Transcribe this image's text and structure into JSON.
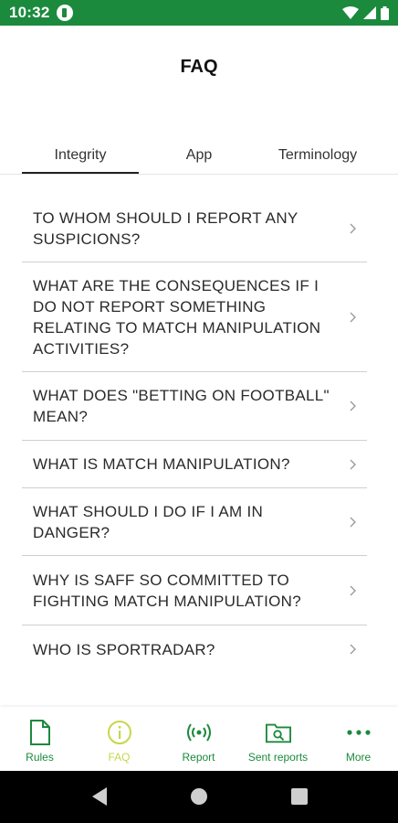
{
  "status_bar": {
    "time": "10:32"
  },
  "header": {
    "title": "FAQ"
  },
  "tabs": [
    {
      "label": "Integrity"
    },
    {
      "label": "App"
    },
    {
      "label": "Terminology"
    }
  ],
  "faq": [
    {
      "question": "TO WHOM SHOULD I REPORT ANY SUSPICIONS?"
    },
    {
      "question": "WHAT ARE THE CONSEQUENCES IF I DO NOT REPORT SOMETHING RELATING TO MATCH MANIPULATION ACTIVITIES?"
    },
    {
      "question": "WHAT DOES \"BETTING ON FOOTBALL\" MEAN?"
    },
    {
      "question": "WHAT IS MATCH MANIPULATION?"
    },
    {
      "question": "WHAT SHOULD I DO IF I AM IN DANGER?"
    },
    {
      "question": "WHY IS SAFF SO COMMITTED TO FIGHTING MATCH MANIPULATION?"
    },
    {
      "question": "WHO IS SPORTRADAR?"
    }
  ],
  "bottom_nav": [
    {
      "label": "Rules",
      "icon": "document-icon"
    },
    {
      "label": "FAQ",
      "icon": "info-icon",
      "active": true
    },
    {
      "label": "Report",
      "icon": "broadcast-icon"
    },
    {
      "label": "Sent reports",
      "icon": "folder-search-icon"
    },
    {
      "label": "More",
      "icon": "more-dots-icon"
    }
  ],
  "colors": {
    "brand_green": "#1b8a3d",
    "active_nav": "#c7d64a"
  }
}
